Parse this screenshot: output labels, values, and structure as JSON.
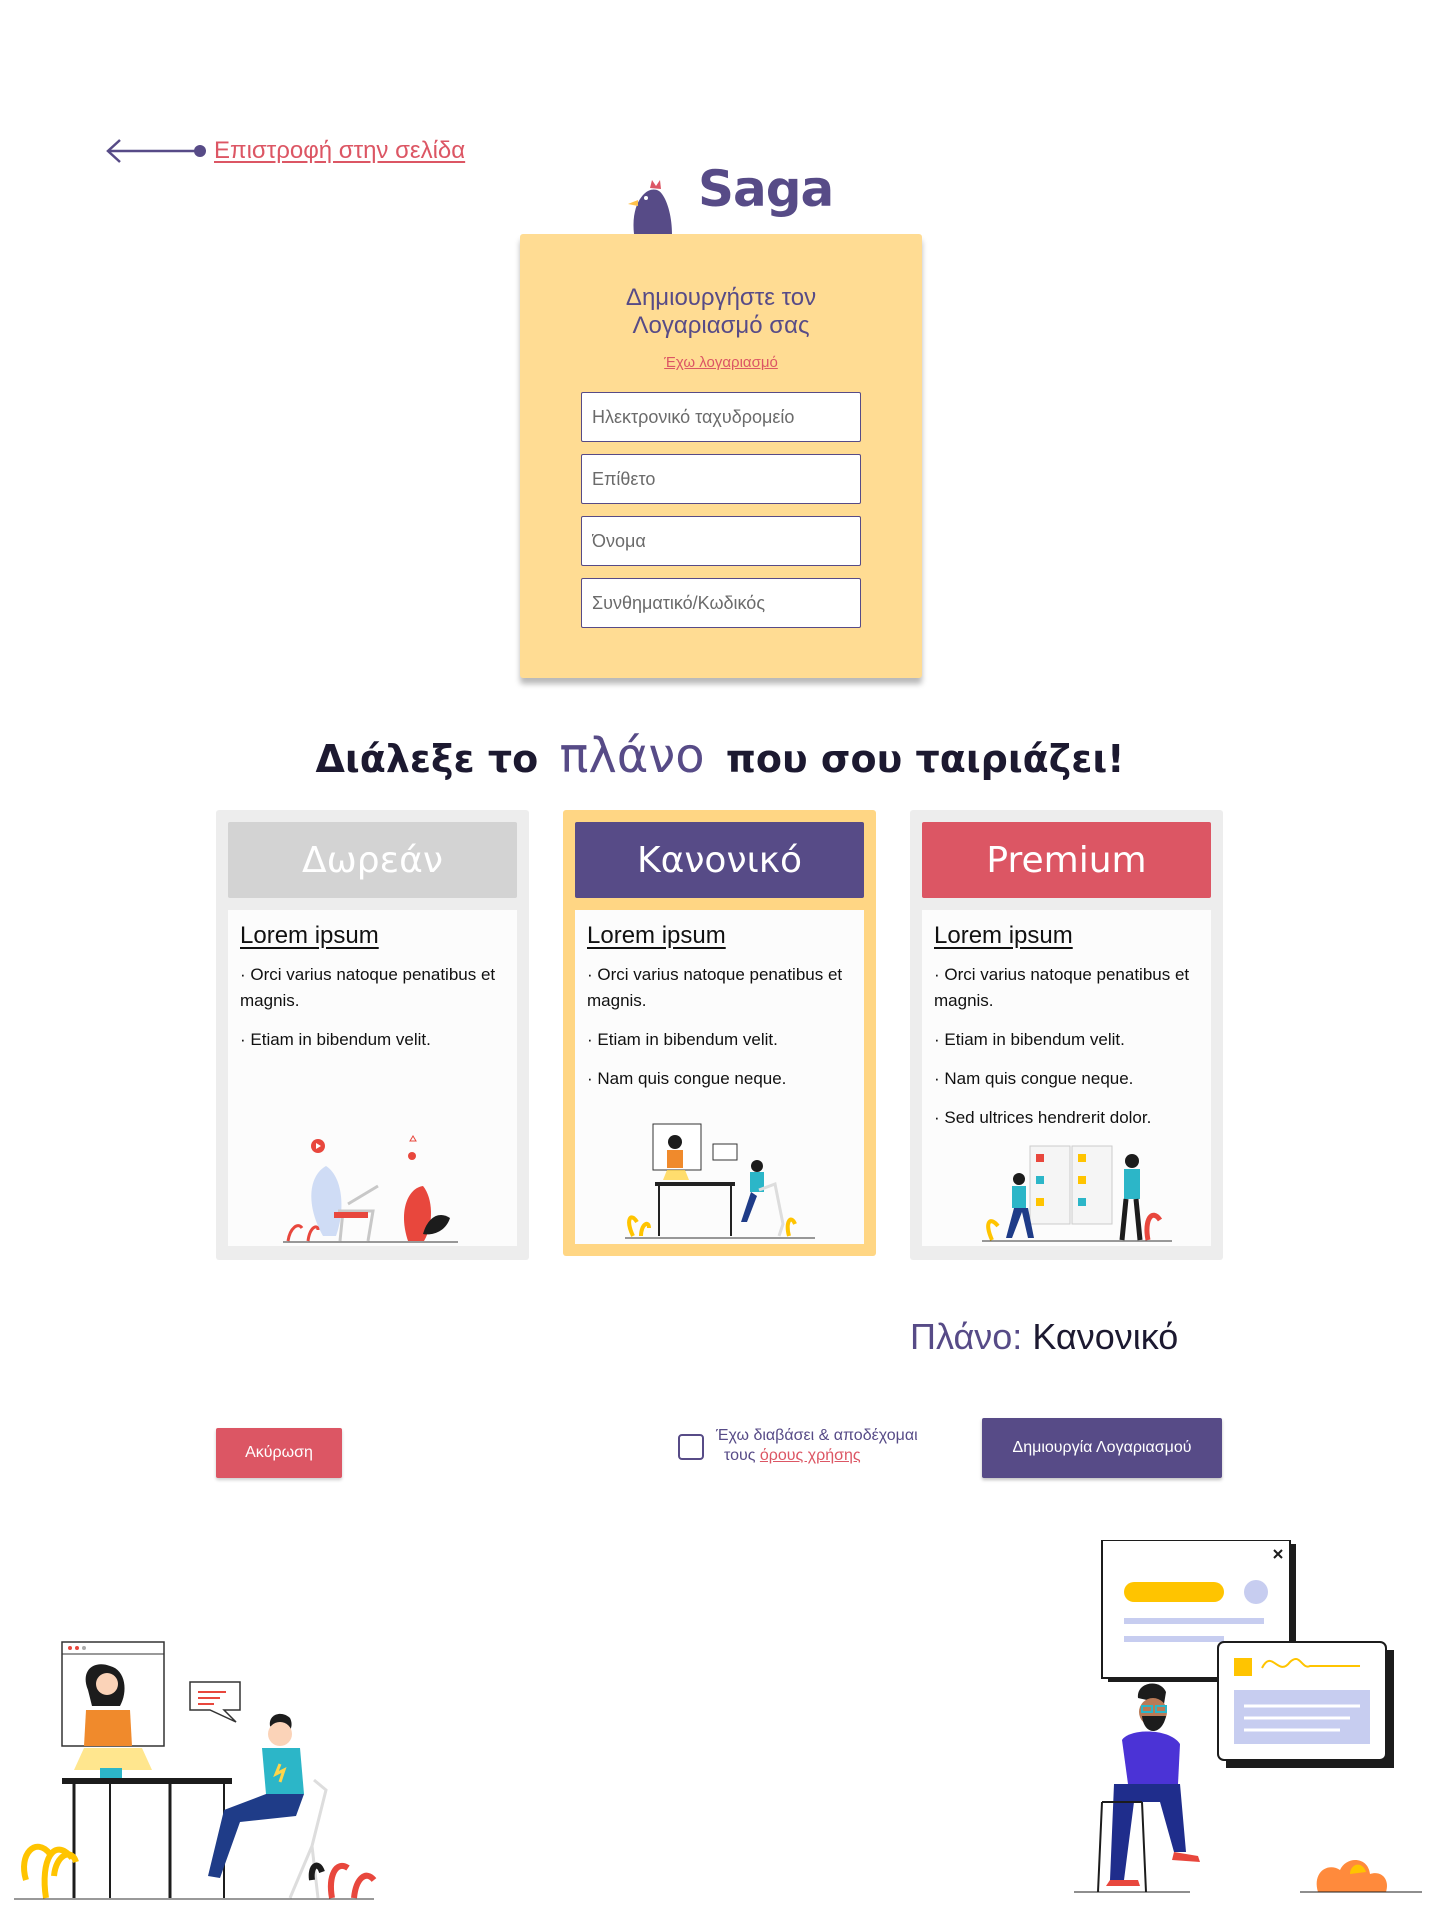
{
  "back_link": {
    "label": "Επιστροφή στην σελίδα"
  },
  "logo": {
    "text": "Saga"
  },
  "signup": {
    "title_line1": "Δημιουργήστε τον",
    "title_line2": "Λογαριασμό σας",
    "login_link": "Έχω λογαριασμό",
    "fields": [
      {
        "placeholder": "Ηλεκτρονικό ταχυδρομείο"
      },
      {
        "placeholder": "Επίθετο"
      },
      {
        "placeholder": "Όνομα"
      },
      {
        "placeholder": "Συνθηματικό/Κωδικός"
      }
    ]
  },
  "plans_heading": {
    "before": "Διάλεξε το",
    "accent": "πλάνο",
    "after": "που σου ταιριάζει!"
  },
  "plans": [
    {
      "name": "Δωρεάν",
      "color": "#d3d3d3",
      "heading": "Lorem ipsum",
      "items": [
        "· Orci varius natoque penatibus et magnis.",
        "· Etiam in bibendum velit."
      ]
    },
    {
      "name": "Κανονικό",
      "color": "#574b87",
      "selected": true,
      "heading": "Lorem ipsum",
      "items": [
        "· Orci varius natoque penatibus et magnis.",
        "· Etiam in bibendum velit.",
        "· Nam quis congue neque."
      ]
    },
    {
      "name": "Premium",
      "color": "#dc5664",
      "heading": "Lorem ipsum",
      "items": [
        "· Orci varius natoque penatibus et magnis.",
        "· Etiam in bibendum velit.",
        "· Nam quis congue neque.",
        "· Sed ultrices hendrerit dolor."
      ]
    }
  ],
  "plan_summary": {
    "label": "Πλάνο:",
    "value": "Κανονικό"
  },
  "actions": {
    "cancel": "Ακύρωση",
    "terms_line1": "Έχω διαβάσει & αποδέχομαι",
    "terms_prefix": "τους",
    "terms_link": "όρους χρήσης",
    "create": "Δημιουργία Λογαριασμού"
  },
  "colors": {
    "primary": "#574b87",
    "accent": "#dc5664",
    "card": "#ffdc93"
  }
}
